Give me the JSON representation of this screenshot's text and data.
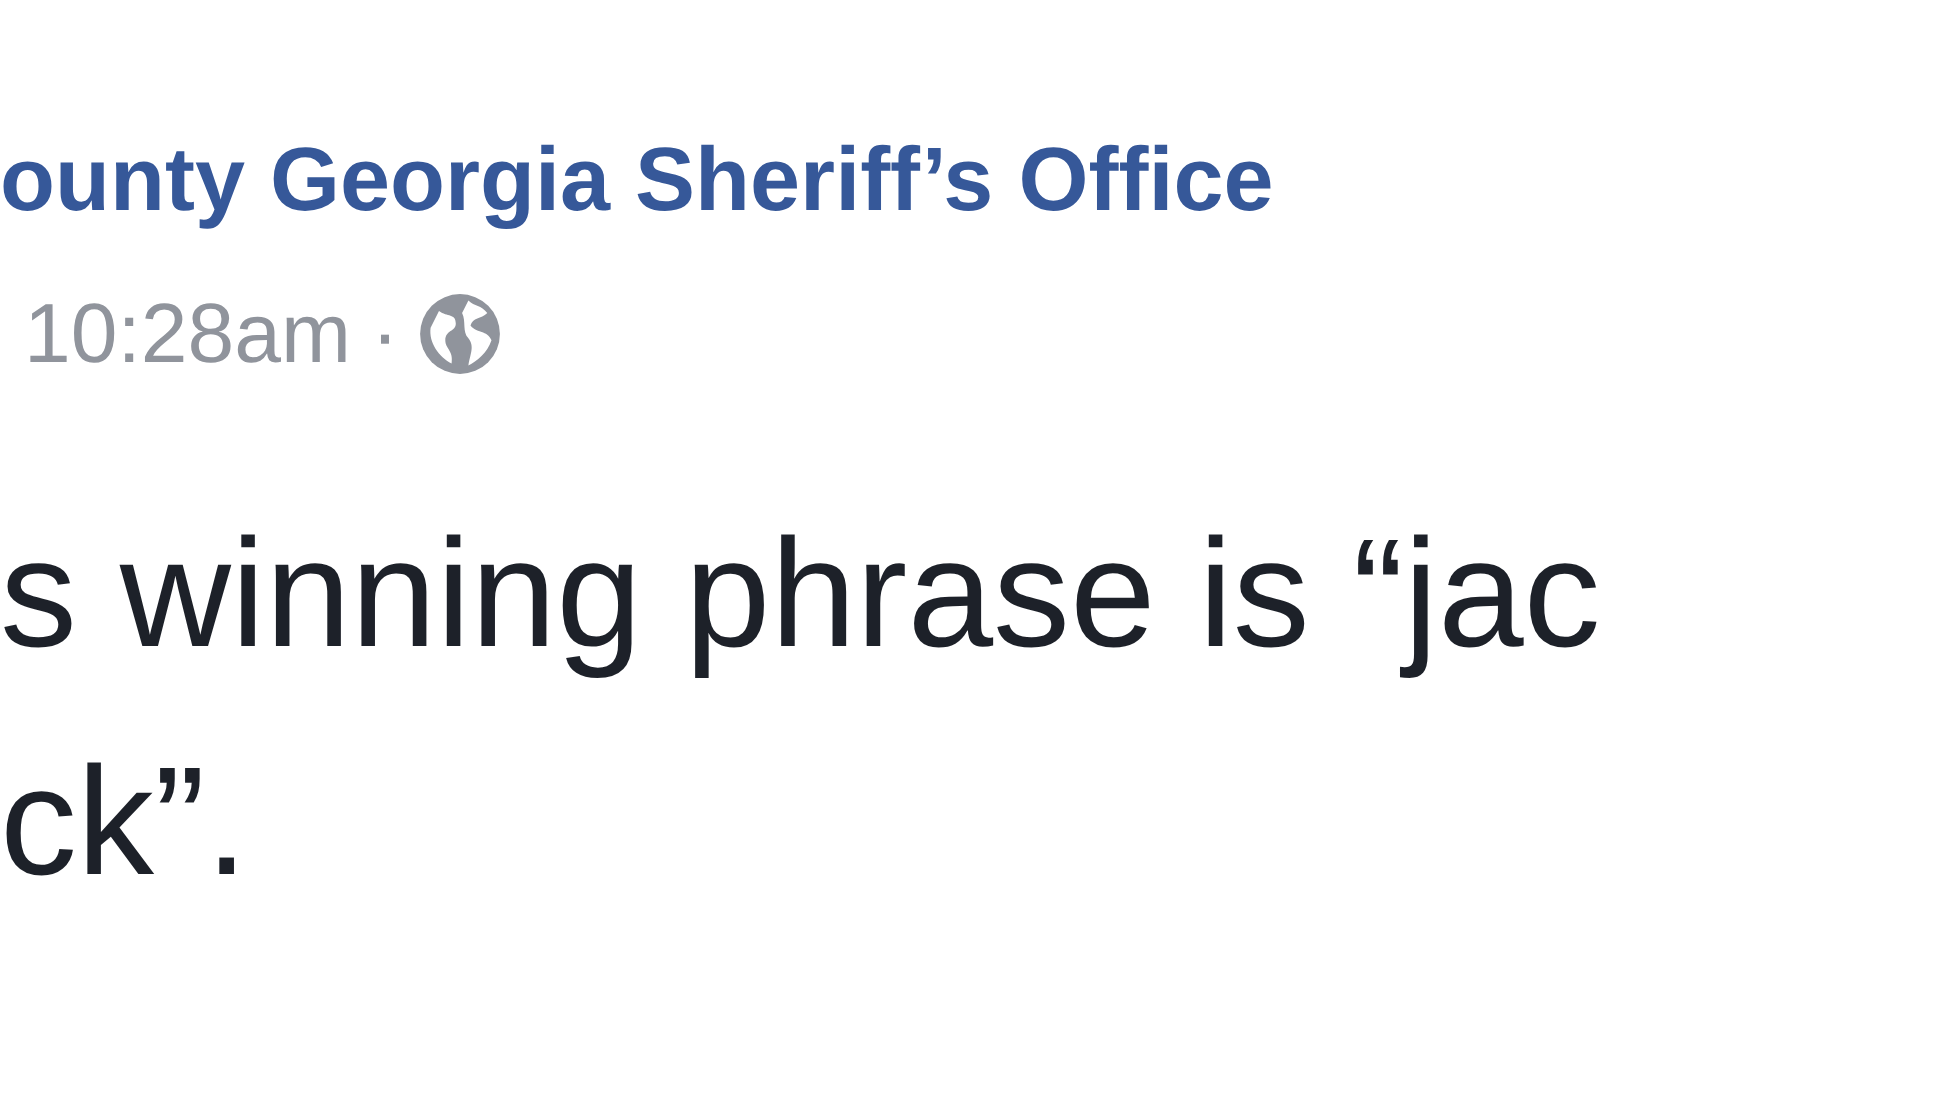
{
  "post": {
    "author": "ounty Georgia Sheriff’s Office",
    "time": "10:28am",
    "separator": "·",
    "body_lines": [
      "s winning phrase is “jac",
      "ck”."
    ]
  }
}
